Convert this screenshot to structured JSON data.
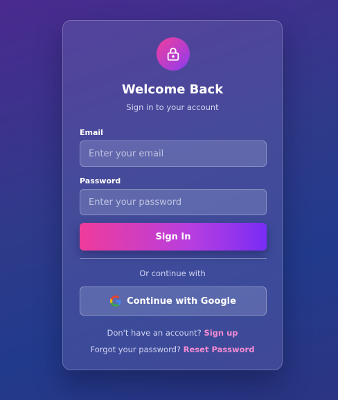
{
  "brand": {
    "icon": "lock-icon",
    "gradient_start": "#f23f9c",
    "gradient_end": "#8b3cf0"
  },
  "header": {
    "title": "Welcome Back",
    "subtitle": "Sign in to your account"
  },
  "form": {
    "email": {
      "label": "Email",
      "value": "",
      "placeholder": "Enter your email"
    },
    "password": {
      "label": "Password",
      "value": "",
      "placeholder": "Enter your password"
    },
    "submit_label": "Sign In"
  },
  "social": {
    "divider_text": "Or continue with",
    "google_label": "Continue with Google",
    "google_icon": "google-icon"
  },
  "footer": {
    "signup_prompt": "Don't have an account?",
    "signup_link": "Sign up",
    "reset_prompt": "Forgot your password?",
    "reset_link": "Reset Password"
  },
  "colors": {
    "link": "#f38bd3",
    "accent_pink": "#ef3c9b",
    "accent_purple": "#7a2cf5"
  }
}
